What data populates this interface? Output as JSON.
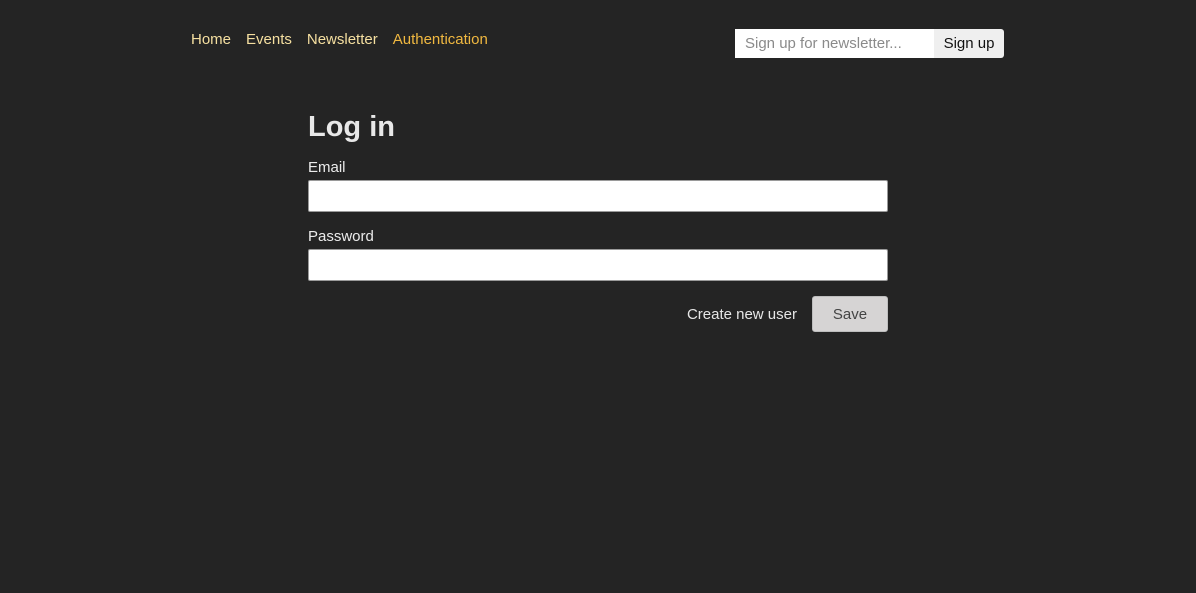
{
  "nav": {
    "items": [
      {
        "label": "Home"
      },
      {
        "label": "Events"
      },
      {
        "label": "Newsletter"
      },
      {
        "label": "Authentication"
      }
    ],
    "active_color": "#f0b840",
    "link_color": "#f5dfa0"
  },
  "newsletter": {
    "placeholder": "Sign up for newsletter...",
    "value": "",
    "button_label": "Sign up"
  },
  "login": {
    "title": "Log in",
    "email_label": "Email",
    "email_value": "",
    "password_label": "Password",
    "password_value": "",
    "create_user_label": "Create new user",
    "save_label": "Save"
  },
  "colors": {
    "background": "#242424"
  }
}
